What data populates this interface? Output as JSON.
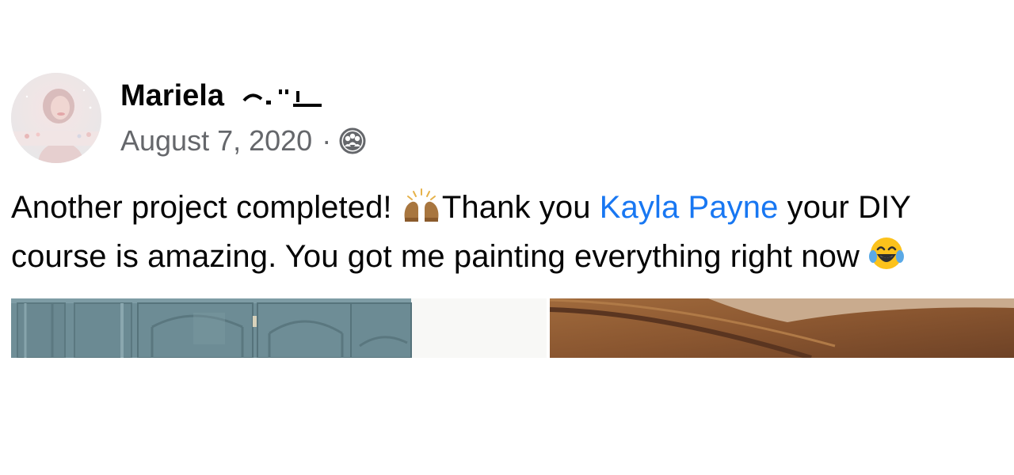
{
  "post": {
    "author": {
      "name": "Mariela",
      "avatar_icon": "profile-photo"
    },
    "date": "August 7, 2020",
    "separator": "·",
    "audience_icon": "friends-icon",
    "text": {
      "part1": "Another project completed! ",
      "part2": "Thank you ",
      "mention": "Kayla Payne",
      "part3": " your DIY",
      "line2": "course is amazing. You got me painting everything right now "
    },
    "emojis": [
      "raising-hands-emoji",
      "tears-of-joy-emoji"
    ],
    "photos": [
      {
        "name": "blue painted cabinets photo"
      },
      {
        "name": "wood cabinet photo"
      }
    ],
    "colors": {
      "text": "#050505",
      "secondary": "#65676b",
      "link": "#1877f2",
      "cabinet_blue": "#6d8d95",
      "wood": "#8a5a36"
    }
  }
}
